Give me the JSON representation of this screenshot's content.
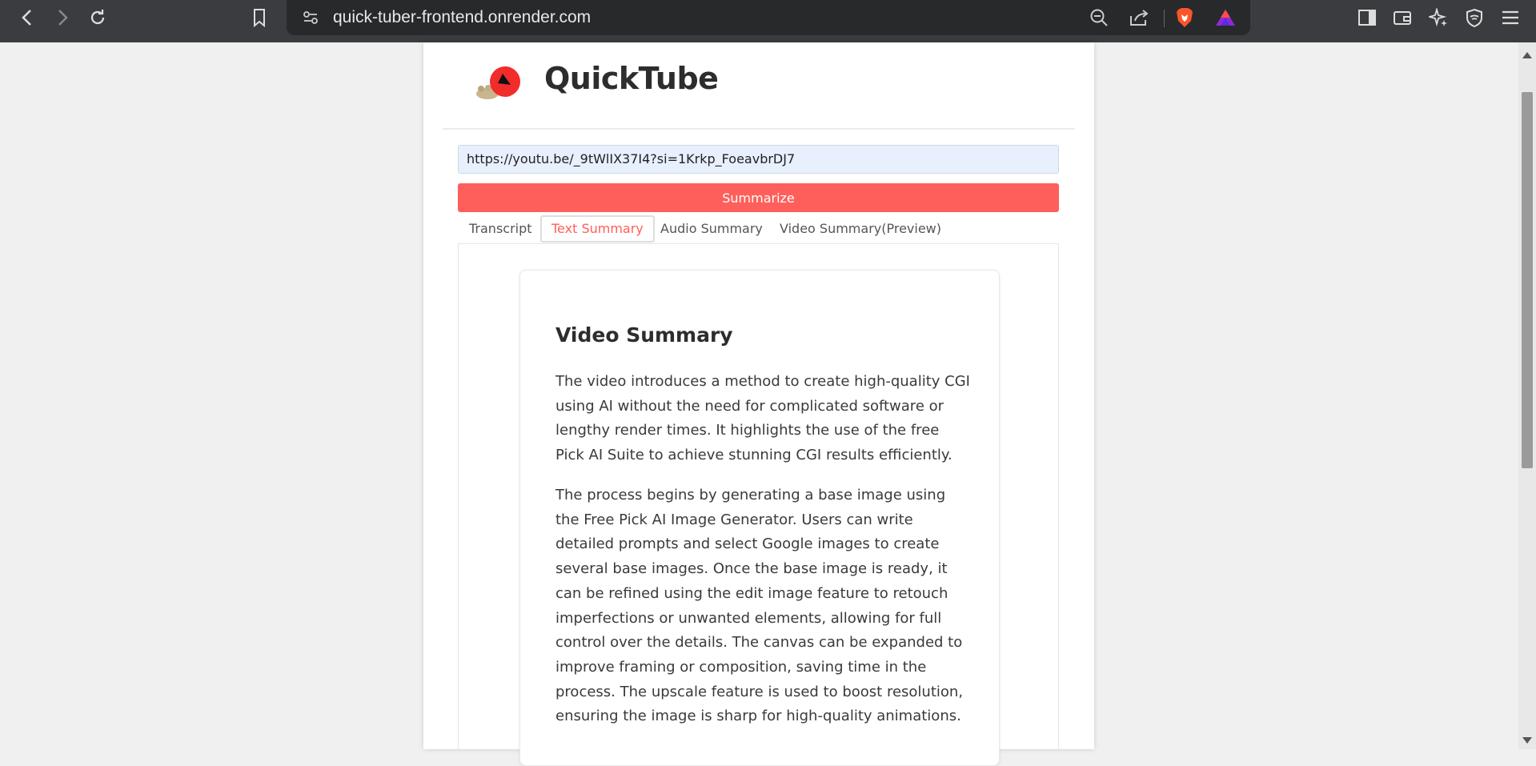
{
  "browser": {
    "url": "quick-tuber-frontend.onrender.com",
    "icons": [
      "back-icon",
      "forward-icon",
      "reload-icon",
      "bookmark-icon",
      "site-settings-icon",
      "zoom-icon",
      "share-icon",
      "brave-shield-icon",
      "brave-rewards-icon",
      "sidebar-icon",
      "wallet-icon",
      "leo-ai-icon",
      "vpn-icon",
      "menu-icon"
    ]
  },
  "app": {
    "title": "QuickTube",
    "accent_color": "#ff5f5a"
  },
  "form": {
    "url_value": "https://youtu.be/_9tWlIX37I4?si=1Krkp_FoeavbrDJ7",
    "summarize_label": "Summarize"
  },
  "tabs": [
    {
      "label": "Transcript",
      "active": false
    },
    {
      "label": "Text Summary",
      "active": true
    },
    {
      "label": "Audio Summary",
      "active": false
    },
    {
      "label": "Video Summary(Preview)",
      "active": false
    }
  ],
  "summary": {
    "heading": "Video Summary",
    "paragraphs": [
      "The video introduces a method to create high-quality CGI using AI without the need for complicated software or lengthy render times. It highlights the use of the free Pick AI Suite to achieve stunning CGI results efficiently.",
      "The process begins by generating a base image using the Free Pick AI Image Generator. Users can write detailed prompts and select Google images to create several base images. Once the base image is ready, it can be refined using the edit image feature to retouch imperfections or unwanted elements, allowing for full control over the details. The canvas can be expanded to improve framing or composition, saving time in the process. The upscale feature is used to boost resolution, ensuring the image is sharp for high-quality animations."
    ]
  }
}
